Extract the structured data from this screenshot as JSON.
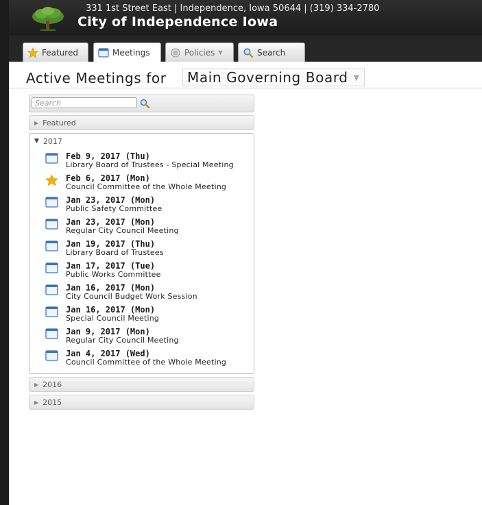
{
  "header": {
    "address": "331 1st Street East | Independence, Iowa 50644 | (319) 334-2780",
    "city": "City of Independence Iowa"
  },
  "tabs": [
    {
      "label": "Featured",
      "icon": "star-icon"
    },
    {
      "label": "Meetings",
      "icon": "calendar-icon"
    },
    {
      "label": "Policies",
      "icon": "policies-icon"
    },
    {
      "label": "Search",
      "icon": "search-icon"
    }
  ],
  "title": {
    "label": "Active Meetings for",
    "board": "Main Governing Board"
  },
  "sidebar": {
    "search_placeholder": "Search",
    "featured_label": "Featured",
    "year_open": "2017",
    "meetings": [
      {
        "date": "Feb 9, 2017 (Thu)",
        "name": "Library Board of Trustees - Special Meeting",
        "icon": "calendar-icon"
      },
      {
        "date": "Feb 6, 2017 (Mon)",
        "name": "Council Committee of the Whole Meeting",
        "icon": "star-icon"
      },
      {
        "date": "Jan 23, 2017 (Mon)",
        "name": "Public Safety Committee",
        "icon": "calendar-icon"
      },
      {
        "date": "Jan 23, 2017 (Mon)",
        "name": "Regular City Council Meeting",
        "icon": "calendar-icon"
      },
      {
        "date": "Jan 19, 2017 (Thu)",
        "name": "Library Board of Trustees",
        "icon": "calendar-icon"
      },
      {
        "date": "Jan 17, 2017 (Tue)",
        "name": "Public Works Committee",
        "icon": "calendar-icon"
      },
      {
        "date": "Jan 16, 2017 (Mon)",
        "name": "City Council Budget Work Session",
        "icon": "calendar-icon"
      },
      {
        "date": "Jan 16, 2017 (Mon)",
        "name": "Special Council Meeting",
        "icon": "calendar-icon"
      },
      {
        "date": "Jan 9, 2017 (Mon)",
        "name": "Regular City Council Meeting",
        "icon": "calendar-icon"
      },
      {
        "date": "Jan 4, 2017 (Wed)",
        "name": "Council Committee of the Whole Meeting",
        "icon": "calendar-icon"
      }
    ],
    "collapsed_years": [
      "2016",
      "2015"
    ]
  }
}
